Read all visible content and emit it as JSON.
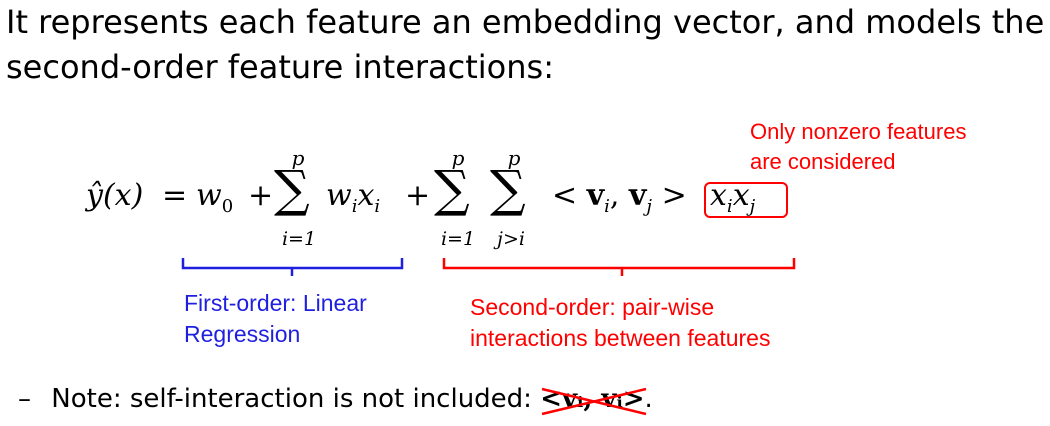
{
  "heading": {
    "line1": "It represents each feature an embedding vector, and models the",
    "line2": "second-order feature interactions:"
  },
  "formula": {
    "lhs": "ŷ(x)",
    "eq": "=",
    "w0": "w",
    "w0_sub": "0",
    "plus": "+",
    "sum_symbol": "∑",
    "sum1_top": "p",
    "sum1_bottom": "i=1",
    "term1": "w",
    "term1_sub": "i",
    "term1_x": "x",
    "term1_x_sub": "i",
    "sum2_top": "p",
    "sum2_bottom": "i=1",
    "sum3_top": "p",
    "sum3_bottom": "j>i",
    "inner_open": "<",
    "v": "v",
    "vi_sub": "i",
    "comma": ",",
    "vj_sub": "j",
    "inner_close": ">",
    "xixj_x1": "x",
    "xixj_sub1": "i",
    "xixj_x2": "x",
    "xixj_sub2": "j"
  },
  "annotations": {
    "nonzero_line1": "Only nonzero features",
    "nonzero_line2": "are considered",
    "first_order_line1": "First-order: Linear",
    "first_order_line2": "Regression",
    "second_order_line1": "Second-order: pair-wise",
    "second_order_line2": "interactions between features"
  },
  "note": {
    "dash": "–",
    "text": "Note: self-interaction is not included:",
    "struck_expr": "<vᵢ, vᵢ>",
    "period": "."
  },
  "colors": {
    "blue": "#1f1fe0",
    "red": "#ff0000"
  }
}
